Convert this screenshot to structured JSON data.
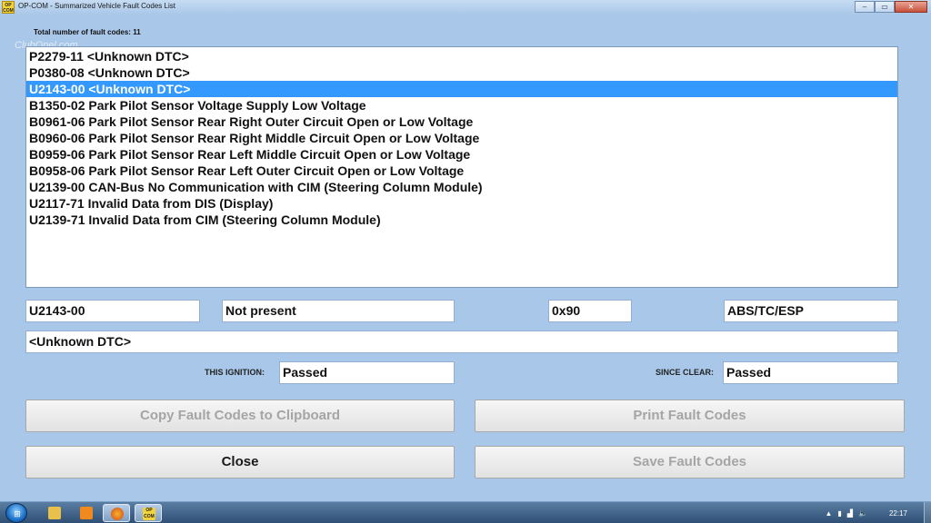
{
  "window": {
    "title": "OP-COM - Summarized Vehicle Fault Codes List",
    "app_icon_text": "OP COM",
    "controls": {
      "minimize": "–",
      "maximize": "▭",
      "close": "✕"
    }
  },
  "header": {
    "fault_count_label": "Total number of fault codes: 11",
    "watermark": "ClubOpel.com"
  },
  "fault_list": {
    "items": [
      "P2279-11 <Unknown DTC>",
      "P0380-08 <Unknown DTC>",
      "U2143-00 <Unknown DTC>",
      "B1350-02 Park Pilot Sensor Voltage Supply Low Voltage",
      "B0961-06 Park Pilot Sensor Rear Right Outer Circuit Open or Low Voltage",
      "B0960-06 Park Pilot Sensor Rear Right Middle Circuit Open or Low Voltage",
      "B0959-06 Park Pilot Sensor Rear Left Middle Circuit Open or Low Voltage",
      "B0958-06 Park Pilot Sensor Rear Left Outer Circuit Open or Low Voltage",
      "U2139-00 CAN-Bus No Communication with CIM (Steering Column Module)",
      "U2117-71 Invalid Data from DIS (Display)",
      "U2139-71 Invalid Data from CIM (Steering Column Module)"
    ],
    "selected_index": 2
  },
  "details": {
    "code": "U2143-00",
    "status": "Not present",
    "hex": "0x90",
    "module": "ABS/TC/ESP",
    "description": "<Unknown DTC>",
    "this_ignition_label": "THIS IGNITION:",
    "this_ignition_value": "Passed",
    "since_clear_label": "SINCE CLEAR:",
    "since_clear_value": "Passed"
  },
  "buttons": {
    "copy": "Copy Fault Codes to Clipboard",
    "print": "Print Fault Codes",
    "close": "Close",
    "save": "Save Fault Codes"
  },
  "taskbar": {
    "clock": "22:17",
    "opcom_label": "OP COM"
  },
  "colors": {
    "background": "#a9c7e8",
    "selection": "#3399ff",
    "disabled_text": "#a5a5a5"
  }
}
